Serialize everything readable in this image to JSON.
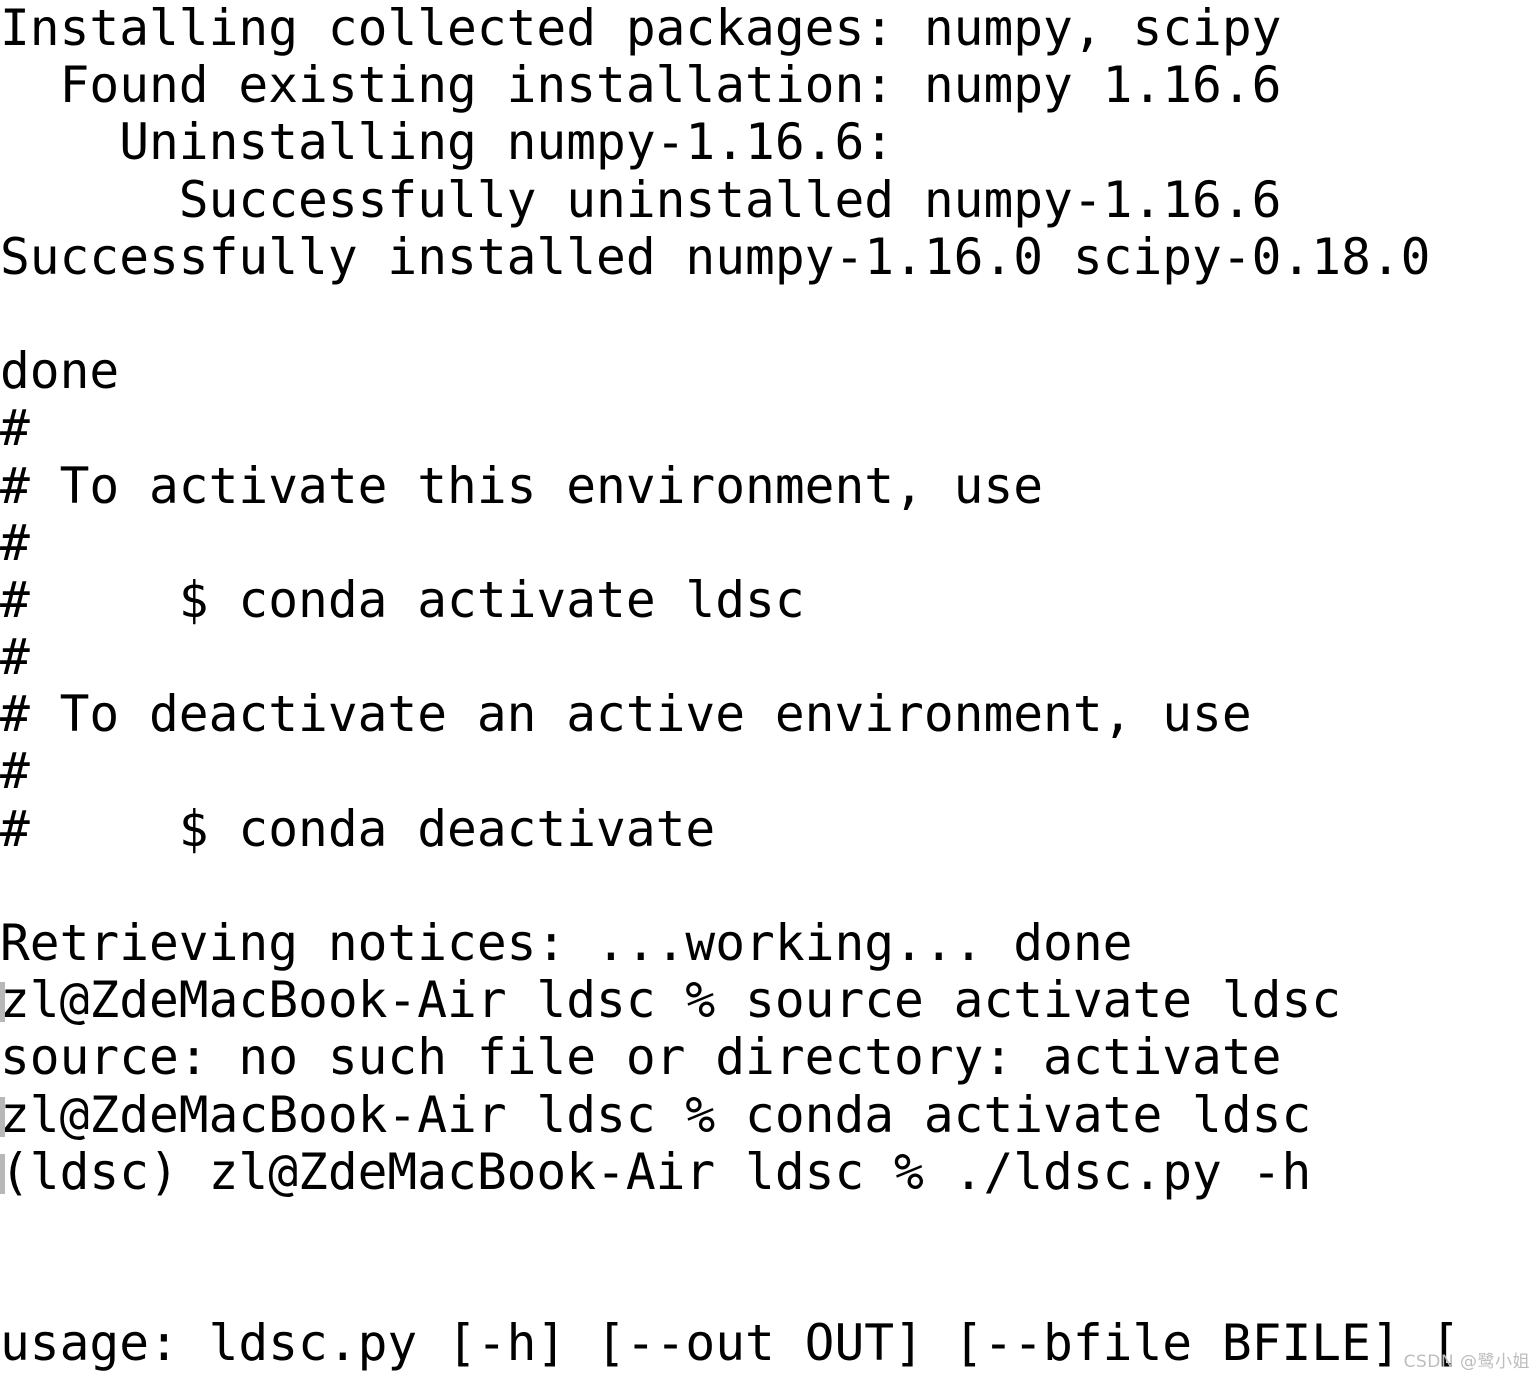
{
  "app": {
    "kind": "terminal-output",
    "shell_prompt_symbol": "%",
    "background_color": "#ffffff",
    "text_color": "#000000"
  },
  "terminal": {
    "lines": [
      {
        "id": "l01",
        "text": "Installing collected packages: numpy, scipy",
        "type": "output"
      },
      {
        "id": "l02",
        "text": "  Found existing installation: numpy 1.16.6",
        "type": "output"
      },
      {
        "id": "l03",
        "text": "    Uninstalling numpy-1.16.6:",
        "type": "output"
      },
      {
        "id": "l04",
        "text": "      Successfully uninstalled numpy-1.16.6",
        "type": "output"
      },
      {
        "id": "l05",
        "text": "Successfully installed numpy-1.16.0 scipy-0.18.0",
        "type": "output"
      },
      {
        "id": "l06",
        "text": "",
        "type": "blank"
      },
      {
        "id": "l07",
        "text": "done",
        "type": "output"
      },
      {
        "id": "l08",
        "text": "#",
        "type": "output"
      },
      {
        "id": "l09",
        "text": "# To activate this environment, use",
        "type": "output"
      },
      {
        "id": "l10",
        "text": "#",
        "type": "output"
      },
      {
        "id": "l11",
        "text": "#     $ conda activate ldsc",
        "type": "output"
      },
      {
        "id": "l12",
        "text": "#",
        "type": "output"
      },
      {
        "id": "l13",
        "text": "# To deactivate an active environment, use",
        "type": "output"
      },
      {
        "id": "l14",
        "text": "#",
        "type": "output"
      },
      {
        "id": "l15",
        "text": "#     $ conda deactivate",
        "type": "output"
      },
      {
        "id": "l16",
        "text": "",
        "type": "blank"
      },
      {
        "id": "l17",
        "text": "Retrieving notices: ...working... done",
        "type": "output"
      },
      {
        "id": "l18",
        "text": "zl@ZdeMacBook-Air ldsc % source activate ldsc",
        "type": "prompt"
      },
      {
        "id": "l19",
        "text": "source: no such file or directory: activate",
        "type": "output"
      },
      {
        "id": "l20",
        "text": "zl@ZdeMacBook-Air ldsc % conda activate ldsc",
        "type": "prompt"
      },
      {
        "id": "l21",
        "text": "(ldsc) zl@ZdeMacBook-Air ldsc % ./ldsc.py -h",
        "type": "prompt"
      },
      {
        "id": "l22",
        "text": "",
        "type": "blank"
      },
      {
        "id": "l23",
        "text": "",
        "type": "blank"
      },
      {
        "id": "l24",
        "text": "usage: ldsc.py [-h] [--out OUT] [--bfile BFILE] [",
        "type": "output"
      }
    ]
  },
  "watermark": {
    "site": "CSDN",
    "handle": "@鹭小姐",
    "color": "#bdbdbd"
  }
}
